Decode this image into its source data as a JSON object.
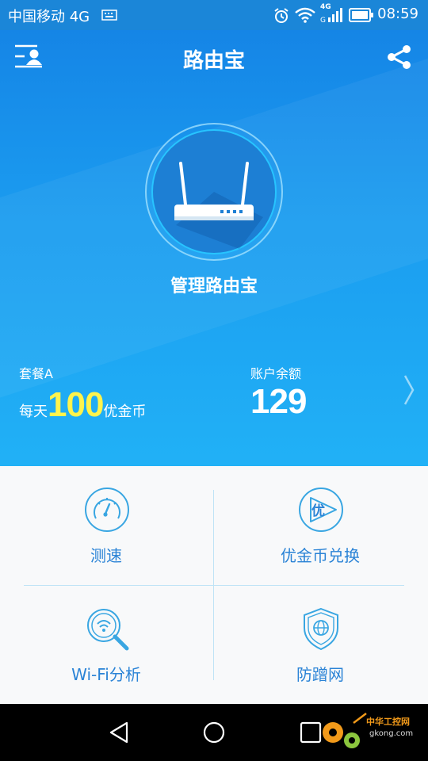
{
  "status_bar": {
    "carrier": "中国移动 4G",
    "network_small": "4G",
    "time": "08:59"
  },
  "app": {
    "title": "路由宝",
    "manage_label": "管理路由宝"
  },
  "package": {
    "name": "套餐A",
    "prefix": "每天",
    "amount": "100",
    "suffix": "优金币"
  },
  "balance": {
    "label": "账户余额",
    "value": "129"
  },
  "features": [
    {
      "label": "测速",
      "icon": "speedometer-icon"
    },
    {
      "label": "优金币兑换",
      "icon": "coin-exchange-icon"
    },
    {
      "label": "Wi-Fi分析",
      "icon": "wifi-analysis-icon"
    },
    {
      "label": "防蹭网",
      "icon": "shield-globe-icon"
    }
  ],
  "speed_icon_glyph": "优",
  "watermark": {
    "text1": "中华工控网",
    "text2": "gkong.com"
  },
  "colors": {
    "primary": "#1b8fe8",
    "accent_number": "#fff44c",
    "feature_text": "#2a83d6"
  }
}
